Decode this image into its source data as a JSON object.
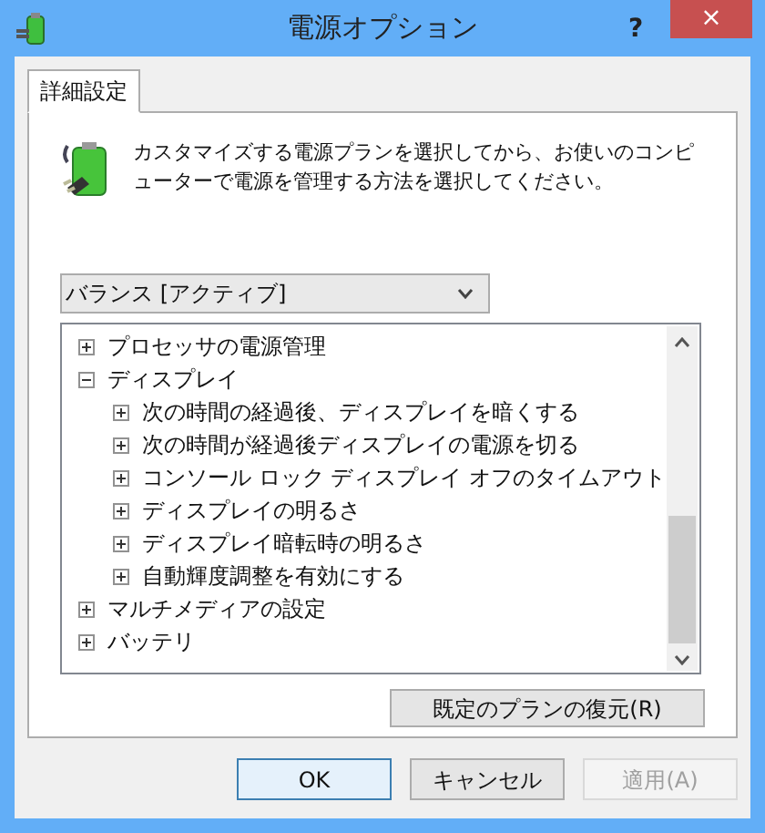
{
  "window": {
    "title": "電源オプション",
    "help": "?",
    "close": "×"
  },
  "tabs": [
    {
      "label": "詳細設定",
      "selected": true
    }
  ],
  "description": "カスタマイズする電源プランを選択してから、お使いのコンピューターで電源を管理する方法を選択してください。",
  "plan_dropdown": {
    "value": "バランス [アクティブ]"
  },
  "tree": [
    {
      "label": "プロセッサの電源管理",
      "expanded": false
    },
    {
      "label": "ディスプレイ",
      "expanded": true,
      "children": [
        {
          "label": "次の時間の経過後、ディスプレイを暗くする",
          "expanded": false
        },
        {
          "label": "次の時間が経過後ディスプレイの電源を切る",
          "expanded": false
        },
        {
          "label": "コンソール ロック ディスプレイ オフのタイムアウト",
          "expanded": false
        },
        {
          "label": "ディスプレイの明るさ",
          "expanded": false
        },
        {
          "label": "ディスプレイ暗転時の明るさ",
          "expanded": false
        },
        {
          "label": "自動輝度調整を有効にする",
          "expanded": false
        }
      ]
    },
    {
      "label": "マルチメディアの設定",
      "expanded": false
    },
    {
      "label": "バッテリ",
      "expanded": false
    }
  ],
  "restore_button": "既定のプランの復元(R)",
  "buttons": [
    {
      "label": "OK",
      "default": true,
      "disabled": false
    },
    {
      "label": "キャンセル",
      "default": false,
      "disabled": false
    },
    {
      "label": "適用(A)",
      "default": false,
      "disabled": true
    }
  ]
}
